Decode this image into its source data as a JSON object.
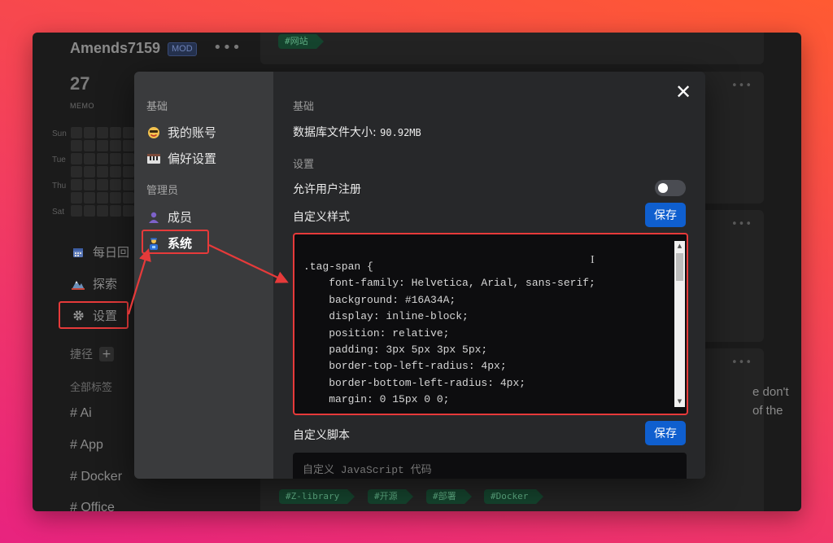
{
  "user": {
    "name": "Amends7159",
    "badge": "MOD",
    "more": "•••"
  },
  "stats": {
    "memo_count": "27",
    "memo_label": "MEMO"
  },
  "heatmap": {
    "days": [
      "Sun",
      "Tue",
      "Thu",
      "Sat"
    ]
  },
  "nav": {
    "daily": "每日回",
    "explore": "探索",
    "settings": "设置"
  },
  "shortcuts": {
    "label": "捷径",
    "add": "+"
  },
  "tags": {
    "label": "全部标签",
    "items": [
      "# Ai",
      "# App",
      "# Docker",
      "# Office"
    ]
  },
  "feed": {
    "top_tag": "#网站",
    "dots": "•••",
    "side_text": "e don't of the",
    "bottom_tags": [
      "#Z-library",
      "#开源",
      "#部署",
      "#Docker"
    ]
  },
  "modal": {
    "close": "✕",
    "sidebar": {
      "section_basic": "基础",
      "account": "我的账号",
      "preferences": "偏好设置",
      "section_admin": "管理员",
      "members": "成员",
      "system": "系统"
    },
    "content": {
      "basic_label": "基础",
      "db_size_label": "数据库文件大小:",
      "db_size_value": "90.92MB",
      "settings_label": "设置",
      "allow_signup": "允许用户注册",
      "allow_signup_enabled": false,
      "custom_style": "自定义样式",
      "save": "保存",
      "custom_style_code": ".tag-span {\n    font-family: Helvetica, Arial, sans-serif;\n    background: #16A34A;\n    display: inline-block;\n    position: relative;\n    padding: 3px 5px 3px 5px;\n    border-top-left-radius: 4px;\n    border-bottom-left-radius: 4px;\n    margin: 0 15px 0 0;",
      "custom_script": "自定义脚本",
      "custom_script_placeholder": "自定义 JavaScript 代码"
    }
  },
  "colors": {
    "accent": "#0f5fcf",
    "annotation": "#e63a3a",
    "tag_bg": "#15442e",
    "tag_text": "#5fae84"
  }
}
